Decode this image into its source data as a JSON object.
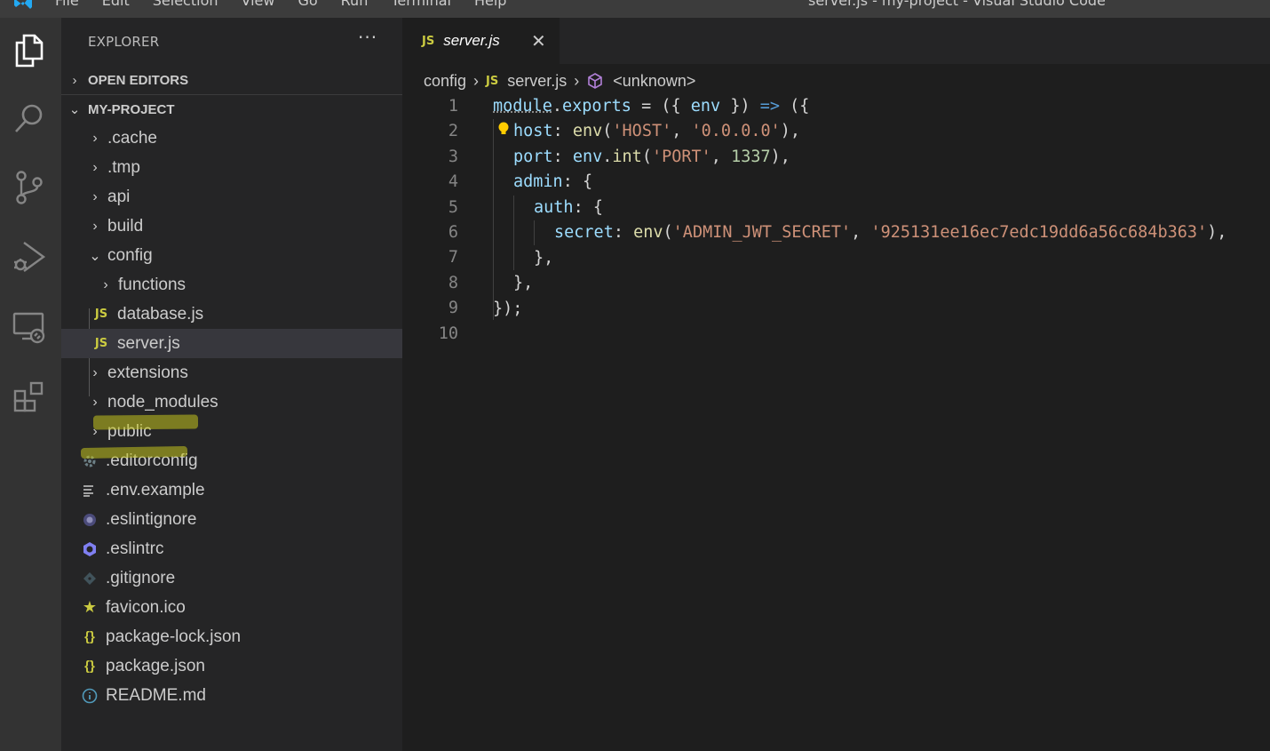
{
  "titlebar": {
    "menu": [
      "File",
      "Edit",
      "Selection",
      "View",
      "Go",
      "Run",
      "Terminal",
      "Help"
    ],
    "window_title": "server.js - my-project - Visual Studio Code"
  },
  "activity_bar": {
    "icons": [
      "explorer-icon",
      "search-icon",
      "source-control-icon",
      "run-debug-icon",
      "remote-explorer-icon",
      "extensions-icon"
    ]
  },
  "sidebar": {
    "title": "EXPLORER",
    "more": "···",
    "open_editors": "OPEN EDITORS",
    "project": "MY-PROJECT",
    "tree": [
      {
        "label": ".cache",
        "type": "folder",
        "expanded": false,
        "depth": 1
      },
      {
        "label": ".tmp",
        "type": "folder",
        "expanded": false,
        "depth": 1
      },
      {
        "label": "api",
        "type": "folder",
        "expanded": false,
        "depth": 1
      },
      {
        "label": "build",
        "type": "folder",
        "expanded": false,
        "depth": 1
      },
      {
        "label": "config",
        "type": "folder",
        "expanded": true,
        "depth": 1
      },
      {
        "label": "functions",
        "type": "folder",
        "expanded": false,
        "depth": 2
      },
      {
        "label": "database.js",
        "type": "js",
        "depth": 2
      },
      {
        "label": "server.js",
        "type": "js",
        "depth": 2,
        "selected": true
      },
      {
        "label": "extensions",
        "type": "folder",
        "expanded": false,
        "depth": 1
      },
      {
        "label": "node_modules",
        "type": "folder",
        "expanded": false,
        "depth": 1
      },
      {
        "label": "public",
        "type": "folder",
        "expanded": false,
        "depth": 1
      },
      {
        "label": ".editorconfig",
        "type": "gear",
        "depth": 1
      },
      {
        "label": ".env.example",
        "type": "lines",
        "depth": 1
      },
      {
        "label": ".eslintignore",
        "type": "eslint-ignore",
        "depth": 1
      },
      {
        "label": ".eslintrc",
        "type": "eslint",
        "depth": 1
      },
      {
        "label": ".gitignore",
        "type": "git",
        "depth": 1
      },
      {
        "label": "favicon.ico",
        "type": "star",
        "depth": 1
      },
      {
        "label": "package-lock.json",
        "type": "json",
        "depth": 1
      },
      {
        "label": "package.json",
        "type": "json",
        "depth": 1
      },
      {
        "label": "README.md",
        "type": "info",
        "depth": 1
      }
    ]
  },
  "tab": {
    "icon_text": "JS",
    "label": "server.js",
    "close": "✕"
  },
  "breadcrumb": {
    "folder": "config",
    "icon_text": "JS",
    "file": "server.js",
    "symbol": "<unknown>",
    "sep": "›"
  },
  "editor": {
    "line_numbers": [
      "1",
      "2",
      "3",
      "4",
      "5",
      "6",
      "7",
      "8",
      "9",
      "10"
    ]
  },
  "colors": {
    "js_icon": "#cbcb41",
    "highlight_marker": "#c4c41e",
    "keyword": "#569cd6",
    "string": "#ce9178",
    "number": "#b5cea8",
    "property": "#9cdcfe",
    "function": "#dcdcaa"
  }
}
